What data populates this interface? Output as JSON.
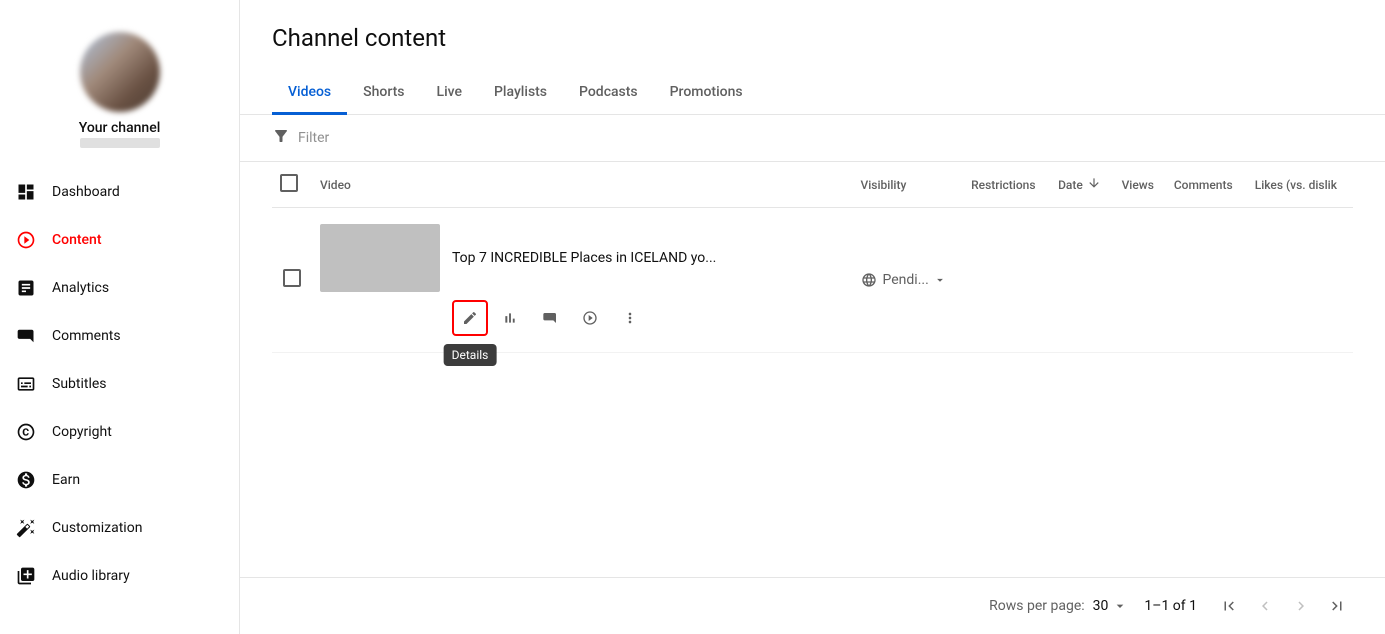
{
  "sidebar": {
    "channel_name": "Your channel",
    "nav_items": [
      {
        "id": "dashboard",
        "label": "Dashboard",
        "icon": "dashboard"
      },
      {
        "id": "content",
        "label": "Content",
        "icon": "content",
        "active": true
      },
      {
        "id": "analytics",
        "label": "Analytics",
        "icon": "analytics"
      },
      {
        "id": "comments",
        "label": "Comments",
        "icon": "comments"
      },
      {
        "id": "subtitles",
        "label": "Subtitles",
        "icon": "subtitles"
      },
      {
        "id": "copyright",
        "label": "Copyright",
        "icon": "copyright"
      },
      {
        "id": "earn",
        "label": "Earn",
        "icon": "earn"
      },
      {
        "id": "customization",
        "label": "Customization",
        "icon": "customization"
      },
      {
        "id": "audio-library",
        "label": "Audio library",
        "icon": "audio-library"
      }
    ]
  },
  "main": {
    "page_title": "Channel content",
    "tabs": [
      {
        "id": "videos",
        "label": "Videos",
        "active": true
      },
      {
        "id": "shorts",
        "label": "Shorts"
      },
      {
        "id": "live",
        "label": "Live"
      },
      {
        "id": "playlists",
        "label": "Playlists"
      },
      {
        "id": "podcasts",
        "label": "Podcasts"
      },
      {
        "id": "promotions",
        "label": "Promotions"
      }
    ],
    "filter_placeholder": "Filter",
    "table": {
      "columns": [
        {
          "id": "video",
          "label": "Video"
        },
        {
          "id": "visibility",
          "label": "Visibility"
        },
        {
          "id": "restrictions",
          "label": "Restrictions"
        },
        {
          "id": "date",
          "label": "Date",
          "sortable": true
        },
        {
          "id": "views",
          "label": "Views"
        },
        {
          "id": "comments",
          "label": "Comments"
        },
        {
          "id": "likes",
          "label": "Likes (vs. dislik"
        }
      ],
      "rows": [
        {
          "title": "Top 7 INCREDIBLE Places in ICELAND yo...",
          "visibility": "Pendi...",
          "restrictions": "",
          "date": "",
          "views": "",
          "comments": "",
          "likes": ""
        }
      ]
    },
    "pagination": {
      "rows_per_page_label": "Rows per page:",
      "rows_per_page_value": "30",
      "page_info": "1–1 of 1"
    },
    "video_actions": {
      "details_tooltip": "Details",
      "details_label": "Details",
      "analytics_label": "Analytics",
      "comments_label": "Comments",
      "watch_label": "Watch",
      "more_label": "More"
    }
  }
}
